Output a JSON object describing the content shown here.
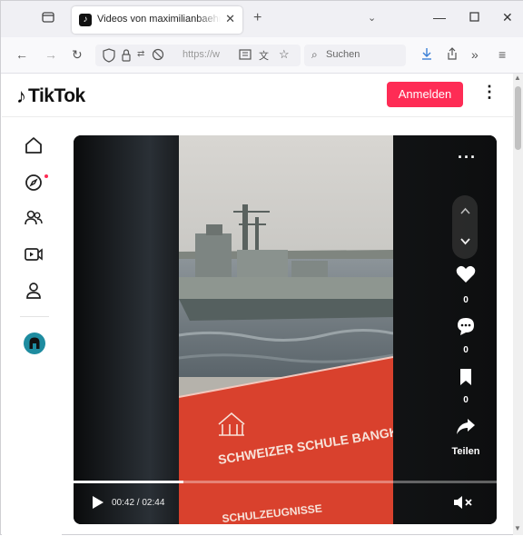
{
  "browser": {
    "tab_title": "Videos von maximilianbaehring",
    "tab_close": "✕",
    "new_tab": "+",
    "tab_list": "⌄",
    "url": "https://w",
    "search_placeholder": "Suchen"
  },
  "tiktok": {
    "logo_text": "TikTok",
    "login_label": "Anmelden",
    "more_label": "⋮"
  },
  "video": {
    "like_count": "0",
    "comment_count": "0",
    "bookmark_count": "0",
    "share_label": "Teilen",
    "time_display": "00:42 / 02:44",
    "progress": 0.26,
    "sign_text_1": "SCHWEIZER SCHULE BANGK",
    "sign_text_2": "SCHULZEUGNISSE"
  },
  "colors": {
    "accent": "#fe2c55",
    "sign_red": "#d9412d"
  }
}
